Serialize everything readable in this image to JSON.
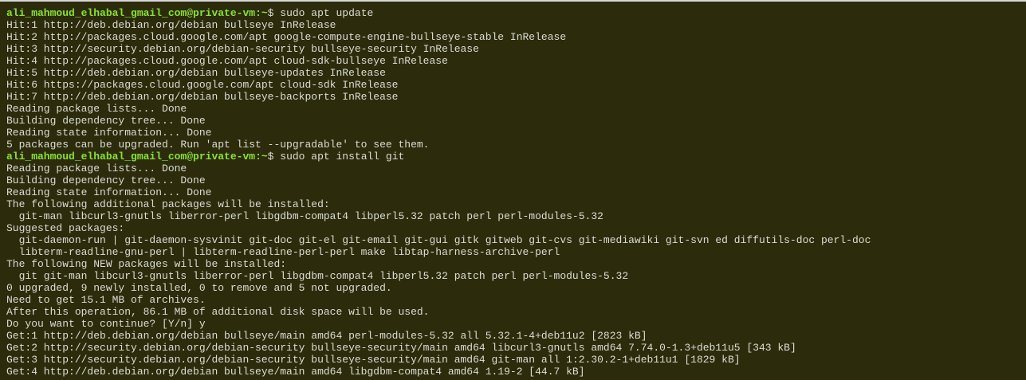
{
  "terminal": {
    "colors": {
      "background": "#2c2c0c",
      "text": "#dcdcd4",
      "prompt": "#8ae234"
    },
    "lines": [
      {
        "type": "prompt",
        "user_host": "ali_mahmoud_elhabal_gmail_com@private-vm",
        "path": ":~",
        "symbol": "$ ",
        "command": "sudo apt update"
      },
      {
        "type": "output",
        "text": "Hit:1 http://deb.debian.org/debian bullseye InRelease"
      },
      {
        "type": "output",
        "text": "Hit:2 http://packages.cloud.google.com/apt google-compute-engine-bullseye-stable InRelease"
      },
      {
        "type": "output",
        "text": "Hit:3 http://security.debian.org/debian-security bullseye-security InRelease"
      },
      {
        "type": "output",
        "text": "Hit:4 http://packages.cloud.google.com/apt cloud-sdk-bullseye InRelease"
      },
      {
        "type": "output",
        "text": "Hit:5 http://deb.debian.org/debian bullseye-updates InRelease"
      },
      {
        "type": "output",
        "text": "Hit:6 https://packages.cloud.google.com/apt cloud-sdk InRelease"
      },
      {
        "type": "output",
        "text": "Hit:7 http://deb.debian.org/debian bullseye-backports InRelease"
      },
      {
        "type": "output",
        "text": "Reading package lists... Done"
      },
      {
        "type": "output",
        "text": "Building dependency tree... Done"
      },
      {
        "type": "output",
        "text": "Reading state information... Done"
      },
      {
        "type": "output",
        "text": "5 packages can be upgraded. Run 'apt list --upgradable' to see them."
      },
      {
        "type": "prompt",
        "user_host": "ali_mahmoud_elhabal_gmail_com@private-vm",
        "path": ":~",
        "symbol": "$ ",
        "command": "sudo apt install git"
      },
      {
        "type": "output",
        "text": "Reading package lists... Done"
      },
      {
        "type": "output",
        "text": "Building dependency tree... Done"
      },
      {
        "type": "output",
        "text": "Reading state information... Done"
      },
      {
        "type": "output",
        "text": "The following additional packages will be installed:"
      },
      {
        "type": "output",
        "text": "  git-man libcurl3-gnutls liberror-perl libgdbm-compat4 libperl5.32 patch perl perl-modules-5.32"
      },
      {
        "type": "output",
        "text": "Suggested packages:"
      },
      {
        "type": "output",
        "text": "  git-daemon-run | git-daemon-sysvinit git-doc git-el git-email git-gui gitk gitweb git-cvs git-mediawiki git-svn ed diffutils-doc perl-doc"
      },
      {
        "type": "output",
        "text": "  libterm-readline-gnu-perl | libterm-readline-perl-perl make libtap-harness-archive-perl"
      },
      {
        "type": "output",
        "text": "The following NEW packages will be installed:"
      },
      {
        "type": "output",
        "text": "  git git-man libcurl3-gnutls liberror-perl libgdbm-compat4 libperl5.32 patch perl perl-modules-5.32"
      },
      {
        "type": "output",
        "text": "0 upgraded, 9 newly installed, 0 to remove and 5 not upgraded."
      },
      {
        "type": "output",
        "text": "Need to get 15.1 MB of archives."
      },
      {
        "type": "output",
        "text": "After this operation, 86.1 MB of additional disk space will be used."
      },
      {
        "type": "output",
        "text": "Do you want to continue? [Y/n] y"
      },
      {
        "type": "output",
        "text": "Get:1 http://deb.debian.org/debian bullseye/main amd64 perl-modules-5.32 all 5.32.1-4+deb11u2 [2823 kB]"
      },
      {
        "type": "output",
        "text": "Get:2 http://security.debian.org/debian-security bullseye-security/main amd64 libcurl3-gnutls amd64 7.74.0-1.3+deb11u5 [343 kB]"
      },
      {
        "type": "output",
        "text": "Get:3 http://security.debian.org/debian-security bullseye-security/main amd64 git-man all 1:2.30.2-1+deb11u1 [1829 kB]"
      },
      {
        "type": "output",
        "text": "Get:4 http://deb.debian.org/debian bullseye/main amd64 libgdbm-compat4 amd64 1.19-2 [44.7 kB]"
      }
    ]
  }
}
